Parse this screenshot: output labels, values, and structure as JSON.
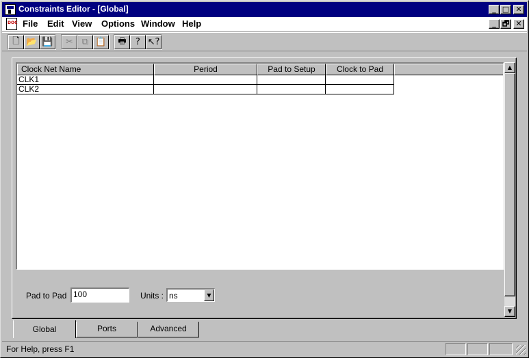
{
  "window": {
    "title": "Constraints Editor - [Global]"
  },
  "caption_buttons": {
    "minimize": "_",
    "maximize": "□",
    "close": "✕",
    "child_restore": "🗗"
  },
  "menu": {
    "doc_icon_text": "DOC",
    "items": [
      "File",
      "Edit",
      "View",
      "Options",
      "Window",
      "Help"
    ]
  },
  "toolbar": {
    "buttons": [
      {
        "icon": "new-icon",
        "glyph": "🗋",
        "enabled": true
      },
      {
        "icon": "open-icon",
        "glyph": "📂",
        "enabled": true
      },
      {
        "icon": "save-icon",
        "glyph": "💾",
        "enabled": true
      },
      {
        "icon": "cut-icon",
        "glyph": "✂",
        "enabled": false
      },
      {
        "icon": "copy-icon",
        "glyph": "⧉",
        "enabled": false
      },
      {
        "icon": "paste-icon",
        "glyph": "📋",
        "enabled": false
      },
      {
        "icon": "print-icon",
        "glyph": "🖶",
        "enabled": true
      },
      {
        "icon": "help-icon",
        "glyph": "?",
        "enabled": true
      },
      {
        "icon": "context-help-icon",
        "glyph": "↖?",
        "enabled": true
      }
    ]
  },
  "grid": {
    "columns": [
      "Clock Net Name",
      "Period",
      "Pad to Setup",
      "Clock to Pad"
    ],
    "rows": [
      [
        "CLK1",
        "",
        "",
        ""
      ],
      [
        "CLK2",
        "",
        "",
        ""
      ]
    ]
  },
  "fields": {
    "pad_to_pad_label": "Pad to Pad",
    "pad_to_pad_value": "100",
    "units_label": "Units :",
    "units_value": "ns"
  },
  "tabs": [
    {
      "label": "Global",
      "active": true
    },
    {
      "label": "Ports",
      "active": false
    },
    {
      "label": "Advanced",
      "active": false
    }
  ],
  "status": {
    "text": "For Help, press F1"
  }
}
